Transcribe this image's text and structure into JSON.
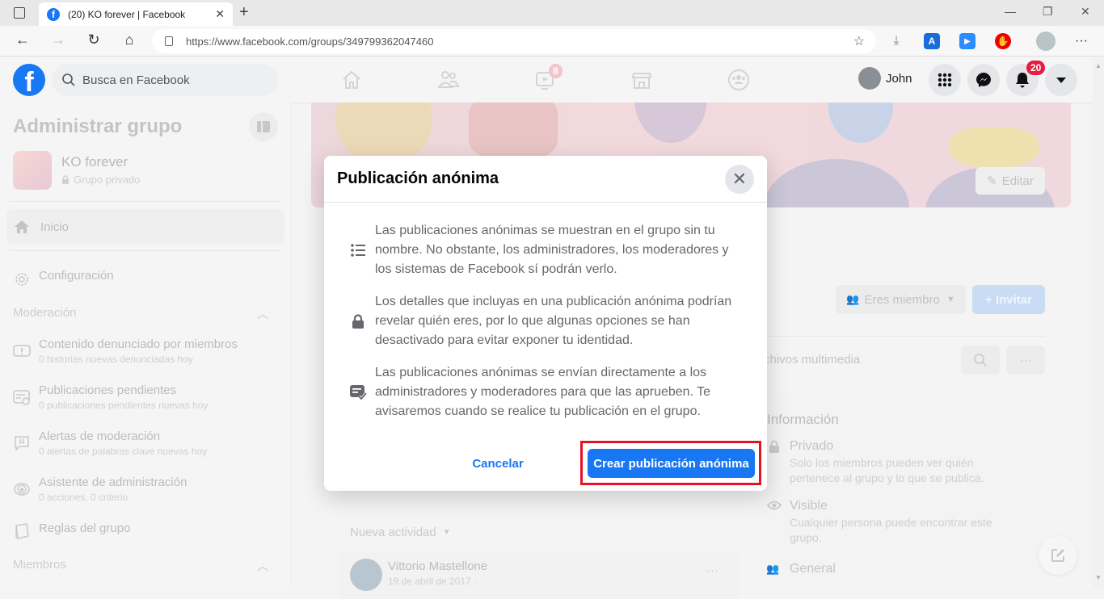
{
  "browser": {
    "tab_title": "(20) KO forever | Facebook",
    "url": "https://www.facebook.com/groups/349799362047460",
    "window_controls": [
      "minimize-icon",
      "restore-icon",
      "close-icon"
    ]
  },
  "header": {
    "logo": "f",
    "search_placeholder": "Busca en Facebook",
    "watch_badge": "8",
    "user_name": "John",
    "notifications_badge": "20",
    "nav_icons": [
      "home-icon",
      "friends-icon",
      "watch-icon",
      "marketplace-icon",
      "groups-icon"
    ]
  },
  "sidebar": {
    "title": "Administrar grupo",
    "group_name": "KO forever",
    "group_privacy": "Grupo privado",
    "home": "Inicio",
    "settings": "Configuración",
    "moderation_header": "Moderación",
    "items": [
      {
        "title": "Contenido denunciado por miembros",
        "sub": "0 historias nuevas denunciadas hoy",
        "icon": "report-icon"
      },
      {
        "title": "Publicaciones pendientes",
        "sub": "0 publicaciones pendientes nuevas hoy",
        "icon": "pending-posts-icon"
      },
      {
        "title": "Alertas de moderación",
        "sub": "0 alertas de palabras clave nuevas hoy",
        "icon": "moderation-alert-icon"
      },
      {
        "title": "Asistente de administración",
        "sub": "0 acciones, 0 criterio",
        "icon": "admin-assist-icon"
      },
      {
        "title": "Reglas del grupo",
        "sub": "",
        "icon": "rules-icon"
      }
    ],
    "members_header": "Miembros"
  },
  "main": {
    "edit_label": "Editar",
    "member_label": "Eres miembro",
    "invite_label": "+ Invitar",
    "tab_partial": "chivos multimedia",
    "new_activity": "Nueva actividad",
    "post_author": "Vittorio Mastellone",
    "post_date": "19 de abril de 2017 ·",
    "info": {
      "title": "Información",
      "private_title": "Privado",
      "private_desc": "Solo los miembros pueden ver quién pertenece al grupo y lo que se publica.",
      "visible_title": "Visible",
      "visible_desc": "Cualquier persona puede encontrar este grupo.",
      "general_title": "General"
    }
  },
  "modal": {
    "title": "Publicación anónima",
    "rows": [
      {
        "icon": "list-icon",
        "text": "Las publicaciones anónimas se muestran en el grupo sin tu nombre. No obstante, los administradores, los moderadores y los sistemas de Facebook sí podrán verlo."
      },
      {
        "icon": "lock-icon",
        "text": "Los detalles que incluyas en una publicación anónima podrían revelar quién eres, por lo que algunas opciones se han desactivado para evitar exponer tu identidad."
      },
      {
        "icon": "approval-icon",
        "text": "Las publicaciones anónimas se envían directamente a los administradores y moderadores para que las aprueben. Te avisaremos cuando se realice tu publicación en el grupo."
      }
    ],
    "cancel_label": "Cancelar",
    "create_label": "Crear publicación anónima",
    "highlight_color": "#e81123",
    "accent_color": "#1877f2"
  }
}
